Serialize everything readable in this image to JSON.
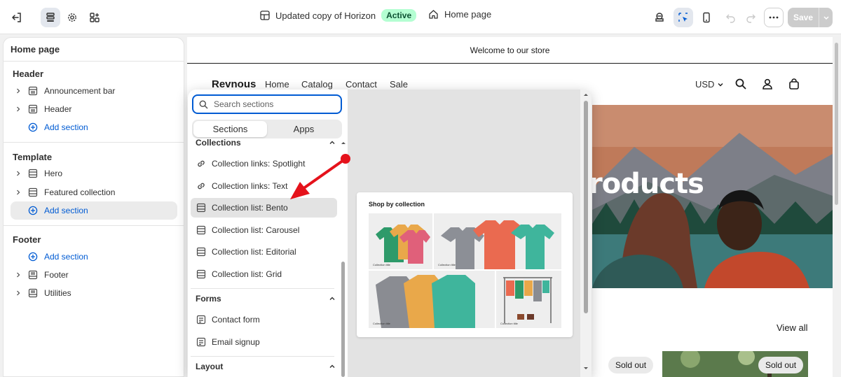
{
  "topbar": {
    "theme_name": "Updated copy of Horizon",
    "theme_status": "Active",
    "page_name": "Home page",
    "save_label": "Save"
  },
  "left_panel": {
    "title": "Home page",
    "groups": {
      "header": {
        "label": "Header",
        "items": [
          "Announcement bar",
          "Header"
        ],
        "add_label": "Add section"
      },
      "template": {
        "label": "Template",
        "items": [
          "Hero",
          "Featured collection"
        ],
        "add_label": "Add section"
      },
      "footer": {
        "label": "Footer",
        "add_label": "Add section",
        "items": [
          "Footer",
          "Utilities"
        ]
      }
    }
  },
  "preview": {
    "announcement": "Welcome to our store",
    "store_name": "Revnous",
    "nav": [
      "Home",
      "Catalog",
      "Contact",
      "Sale"
    ],
    "currency": "USD",
    "hero_text": "roducts",
    "view_all": "View all",
    "sold_out_1": "Sold out",
    "sold_out_2": "Sold out"
  },
  "picker": {
    "search_placeholder": "Search sections",
    "tabs": [
      "Sections",
      "Apps"
    ],
    "active_tab": "Sections",
    "groups": {
      "collections": {
        "label": "Collections",
        "items": [
          "Collection links: Spotlight",
          "Collection links: Text",
          "Collection list: Bento",
          "Collection list: Carousel",
          "Collection list: Editorial",
          "Collection list: Grid"
        ],
        "highlighted": "Collection list: Bento"
      },
      "forms": {
        "label": "Forms",
        "items": [
          "Contact form",
          "Email signup"
        ]
      },
      "layout": {
        "label": "Layout"
      }
    },
    "preview_card": {
      "title": "Shop by collection",
      "tile_caption": "Collection title"
    }
  },
  "colors": {
    "accent_blue": "#005bd3",
    "active_badge_bg": "#b4fed2",
    "annotation_arrow": "#e5121b",
    "save_disabled": "#cccccc"
  }
}
